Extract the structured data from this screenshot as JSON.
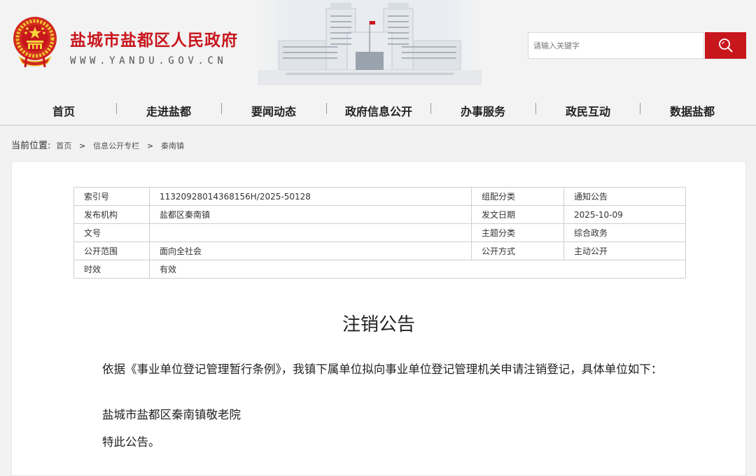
{
  "header": {
    "site_name": "盐城市盐都区人民政府",
    "site_domain": "WWW.YANDU.GOV.CN",
    "search_placeholder": "请输入关键字"
  },
  "nav": [
    "首页",
    "走进盐都",
    "要闻动态",
    "政府信息公开",
    "办事服务",
    "政民互动",
    "数据盐都"
  ],
  "breadcrumb": {
    "label": "当前位置:",
    "items": [
      "首页",
      "信息公开专栏",
      "秦南镇"
    ],
    "separator": ">"
  },
  "meta": {
    "index_label": "索引号",
    "index_value": "11320928014368156H/2025-50128",
    "category_label": "组配分类",
    "category_value": "通知公告",
    "publisher_label": "发布机构",
    "publisher_value": "盐都区秦南镇",
    "date_label": "发文日期",
    "date_value": "2025-10-09",
    "docno_label": "文号",
    "docno_value": "",
    "topic_label": "主题分类",
    "topic_value": "综合政务",
    "scope_label": "公开范围",
    "scope_value": "面向全社会",
    "mode_label": "公开方式",
    "mode_value": "主动公开",
    "validity_label": "时效",
    "validity_value": "有效"
  },
  "article": {
    "title": "注销公告",
    "paragraphs": [
      "依据《事业单位登记管理暂行条例》，我镇下属单位拟向事业单位登记管理机关申请注销登记，具体单位如下：",
      "盐城市盐都区秦南镇敬老院",
      "特此公告。"
    ]
  },
  "colors": {
    "brand_red": "#c8161d",
    "gold": "#f2c230"
  },
  "icons": {
    "emblem": "national-emblem-icon",
    "search": "search-icon"
  }
}
